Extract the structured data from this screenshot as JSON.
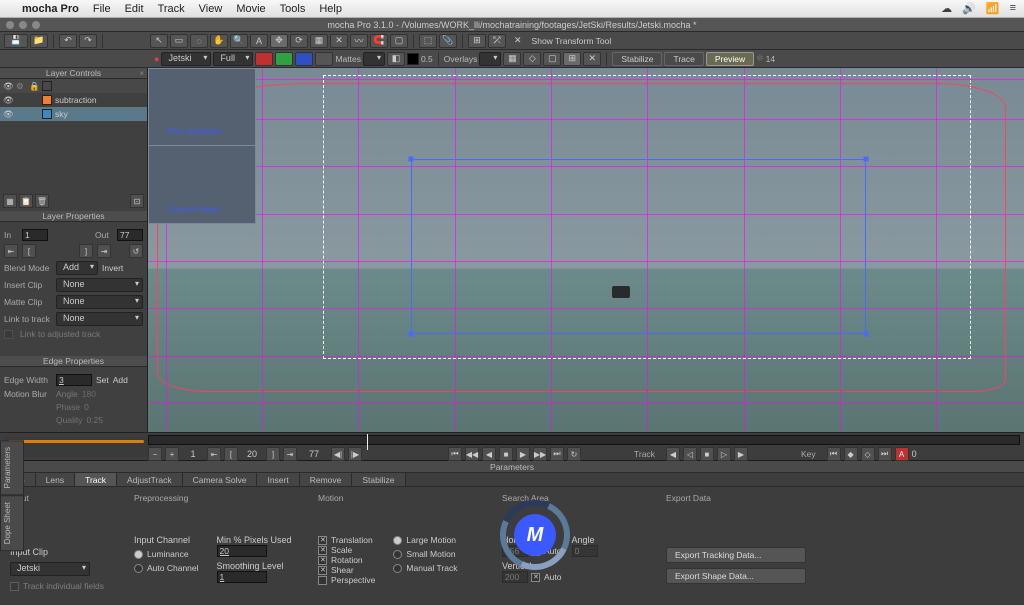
{
  "menubar": {
    "apple": "",
    "app": "mocha Pro",
    "items": [
      "File",
      "Edit",
      "Track",
      "View",
      "Movie",
      "Tools",
      "Help"
    ],
    "right_icons": [
      "☁",
      "🔊",
      "📶",
      "≡"
    ]
  },
  "window": {
    "title": "mocha Pro 3.1.0 - /Volumes/WORK_lli/mochatraining/footages/JetSki/Results/Jetski.mocha *"
  },
  "toolbar1": {
    "hint_icon": "✕",
    "hint": "Show Transform Tool"
  },
  "toolbar2": {
    "clip_dropdown": "Jetski",
    "res_dropdown": "Full",
    "mattes_label": "Mattes",
    "overlays_label": "Overlays",
    "opacity": "0.5",
    "btn_stabilize": "Stabilize",
    "btn_trace": "Trace",
    "btn_preview": "Preview",
    "zoom": "14"
  },
  "layers": {
    "panel_title": "Layer Controls",
    "items": [
      {
        "name": "subtraction",
        "color": "#f08030"
      },
      {
        "name": "sky",
        "color": "#3a8ac0"
      }
    ]
  },
  "layer_props": {
    "panel_title": "Layer Properties",
    "in_label": "In",
    "in_val": "1",
    "out_label": "Out",
    "out_val": "77",
    "blend_label": "Blend Mode",
    "blend_val": "Add",
    "invert": "Invert",
    "insert_label": "Insert Clip",
    "insert_val": "None",
    "matte_label": "Matte Clip",
    "matte_val": "None",
    "link_label": "Link to track",
    "link_val": "None",
    "link_adjust": "Link to adjusted track"
  },
  "edge_props": {
    "panel_title": "Edge Properties",
    "width_label": "Edge Width",
    "width_val": "3",
    "set": "Set",
    "add": "Add",
    "mb_label": "Motion Blur",
    "angle_label": "Angle",
    "angle_val": "180",
    "phase_label": "Phase",
    "phase_val": "0",
    "quality_label": "Quality",
    "quality_val": "0.25"
  },
  "timeline": {
    "start": "1",
    "mid": "20",
    "cur": "77",
    "sec_track": "Track",
    "sec_key": "Key",
    "letter": "A",
    "zero": "0"
  },
  "viewer_preview": {
    "prev": "Prev. Keyframe",
    "cur": "Current Frame"
  },
  "bottom": {
    "bar_title": "Parameters",
    "tabs": [
      "Clip",
      "Lens",
      "Track",
      "AdjustTrack",
      "Camera Solve",
      "Insert",
      "Remove",
      "Stabilize"
    ],
    "active_tab": "Track",
    "col_input": {
      "hdr": "Input",
      "clip_label": "Input Clip",
      "clip_val": "Jetski",
      "trk_fields": "Track individual fields"
    },
    "col_pre": {
      "hdr": "Preprocessing",
      "channel_hdr": "Input Channel",
      "luminance": "Luminance",
      "auto": "Auto Channel",
      "minpx_hdr": "Min % Pixels Used",
      "minpx_val": "20",
      "smooth_hdr": "Smoothing Level",
      "smooth_val": "1"
    },
    "col_motion": {
      "hdr": "Motion",
      "translation": "Translation",
      "scale": "Scale",
      "rotation": "Rotation",
      "shear": "Shear",
      "perspective": "Perspective",
      "large": "Large Motion",
      "small": "Small Motion",
      "manual": "Manual Track"
    },
    "col_search": {
      "hdr": "Search Area",
      "horiz": "Horizontal",
      "vert": "Vertical",
      "auto": "Auto",
      "angle": "Angle",
      "h_val": "356",
      "v_val": "200",
      "a_val": "0"
    },
    "col_export": {
      "hdr": "Export Data",
      "btn1": "Export Tracking Data...",
      "btn2": "Export Shape Data..."
    }
  },
  "side_tabs": [
    "Parameters",
    "Dope Sheet"
  ]
}
